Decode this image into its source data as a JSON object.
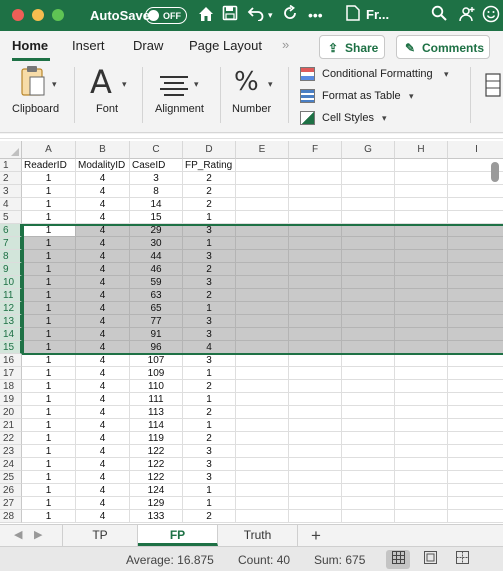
{
  "titlebar": {
    "autosave_label": "AutoSave",
    "autosave_state": "OFF",
    "title": "Fr...",
    "icons": [
      "home-icon",
      "save-icon",
      "undo-icon",
      "redo-icon",
      "more-icon",
      "search-icon",
      "share-person-icon",
      "smiley-icon"
    ]
  },
  "ribbon_tabs": {
    "items": [
      "Home",
      "Insert",
      "Draw",
      "Page Layout"
    ],
    "more_glyph": "»",
    "share_label": "Share",
    "comments_label": "Comments",
    "share_glyph": "⇪",
    "comments_glyph": "✎"
  },
  "ribbon": {
    "clipboard": "Clipboard",
    "font": "Font",
    "font_glyph": "A",
    "alignment": "Alignment",
    "number": "Number",
    "number_glyph": "%",
    "conditional_formatting": "Conditional Formatting",
    "format_as_table": "Format as Table",
    "cell_styles": "Cell Styles"
  },
  "sheet": {
    "columns": [
      "A",
      "B",
      "C",
      "D",
      "E",
      "F",
      "G",
      "H",
      "I"
    ],
    "header_row": [
      "ReaderID",
      "ModalityID",
      "CaseID",
      "FP_Rating"
    ],
    "rows": [
      [
        "1",
        "4",
        "3",
        "2"
      ],
      [
        "1",
        "4",
        "8",
        "2"
      ],
      [
        "1",
        "4",
        "14",
        "2"
      ],
      [
        "1",
        "4",
        "15",
        "1"
      ],
      [
        "1",
        "4",
        "29",
        "3"
      ],
      [
        "1",
        "4",
        "30",
        "1"
      ],
      [
        "1",
        "4",
        "44",
        "3"
      ],
      [
        "1",
        "4",
        "46",
        "2"
      ],
      [
        "1",
        "4",
        "59",
        "3"
      ],
      [
        "1",
        "4",
        "63",
        "2"
      ],
      [
        "1",
        "4",
        "65",
        "1"
      ],
      [
        "1",
        "4",
        "77",
        "3"
      ],
      [
        "1",
        "4",
        "91",
        "3"
      ],
      [
        "1",
        "4",
        "96",
        "4"
      ],
      [
        "1",
        "4",
        "107",
        "3"
      ],
      [
        "1",
        "4",
        "109",
        "1"
      ],
      [
        "1",
        "4",
        "110",
        "2"
      ],
      [
        "1",
        "4",
        "111",
        "1"
      ],
      [
        "1",
        "4",
        "113",
        "2"
      ],
      [
        "1",
        "4",
        "114",
        "1"
      ],
      [
        "1",
        "4",
        "119",
        "2"
      ],
      [
        "1",
        "4",
        "122",
        "3"
      ],
      [
        "1",
        "4",
        "122",
        "3"
      ],
      [
        "1",
        "4",
        "122",
        "3"
      ],
      [
        "1",
        "4",
        "124",
        "1"
      ],
      [
        "1",
        "4",
        "129",
        "1"
      ],
      [
        "1",
        "4",
        "133",
        "2"
      ]
    ],
    "selected_rows": [
      6,
      7,
      8,
      9,
      10,
      11,
      12,
      13,
      14,
      15
    ],
    "active_cell": "A6"
  },
  "sheet_tabs": {
    "items": [
      "TP",
      "FP",
      "Truth"
    ],
    "active": "FP",
    "add_label": "+",
    "prev_glyph": "◀",
    "next_glyph": "▶"
  },
  "status": {
    "average": "Average: 16.875",
    "count": "Count: 40",
    "sum": "Sum: 675",
    "views": [
      "normal-view-icon",
      "page-layout-view-icon",
      "page-break-view-icon"
    ]
  },
  "colors": {
    "accent": "#1e7145",
    "selection_fill": "#c9c9c9",
    "selected_header": "#d2e5da"
  }
}
